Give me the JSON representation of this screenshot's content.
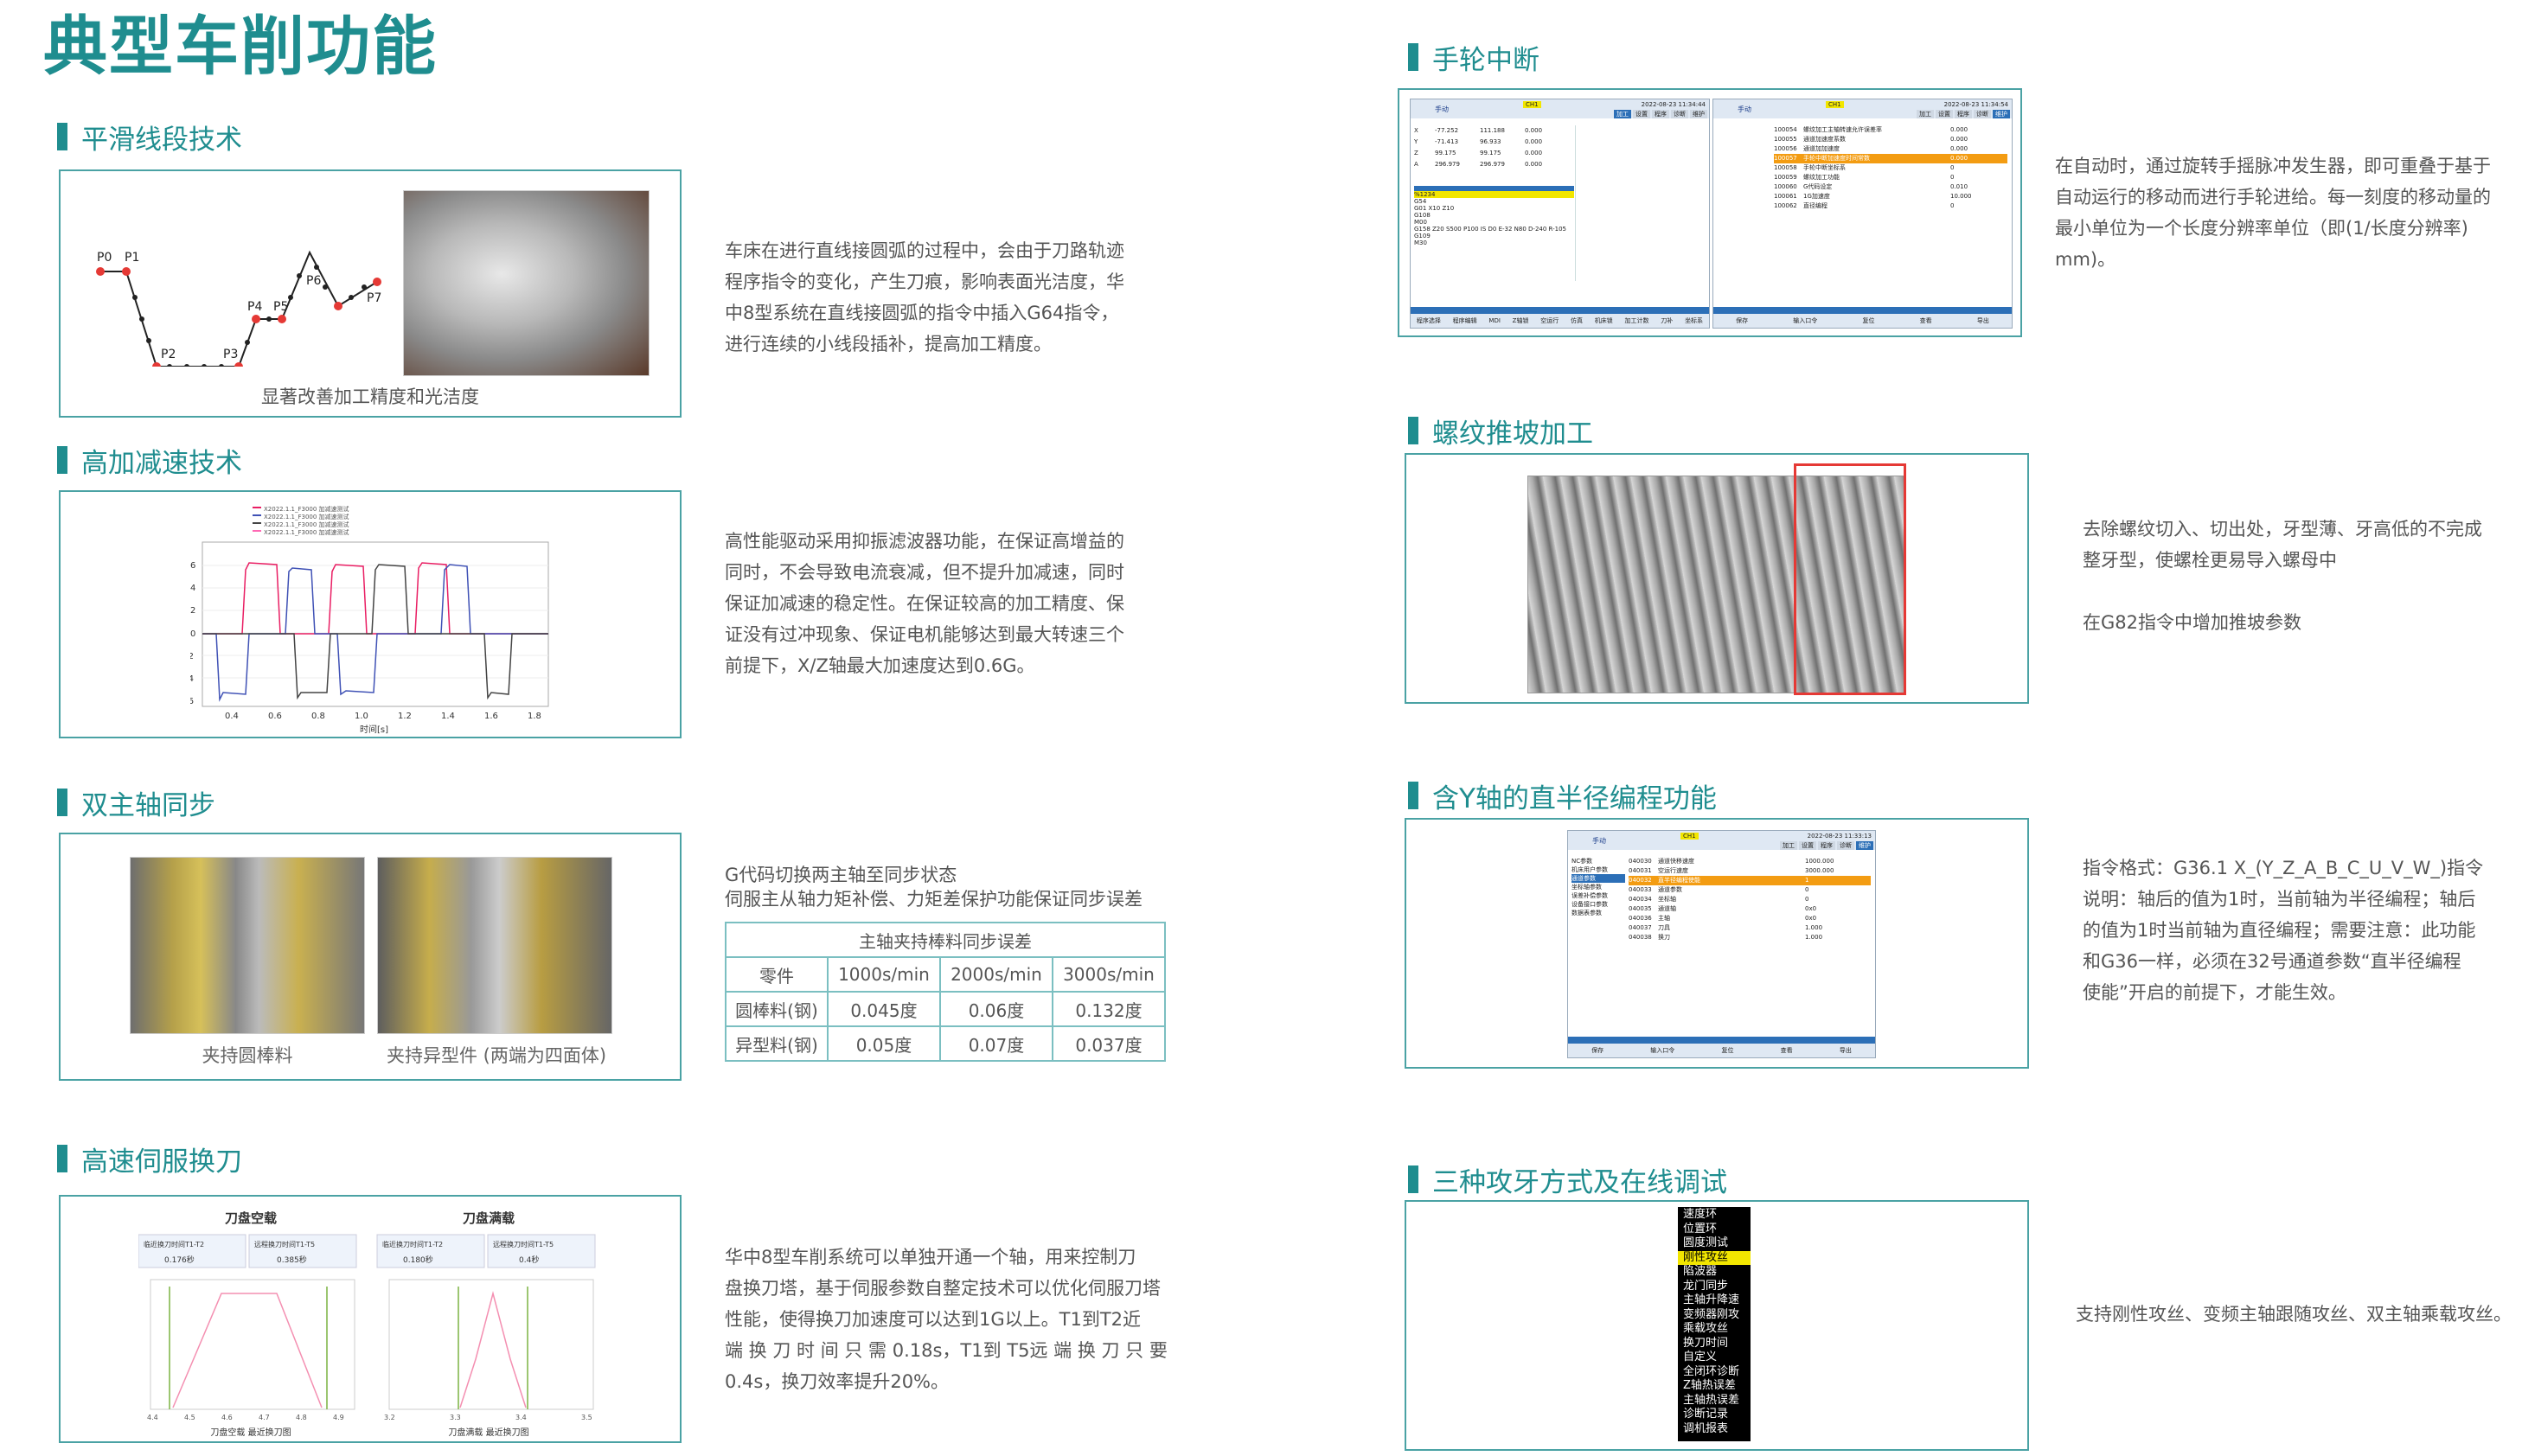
{
  "page": {
    "title": "典型车削功能"
  },
  "sections": {
    "smooth": {
      "title": "平滑线段技术",
      "caption": "显著改善加工精度和光洁度",
      "desc": [
        "车床在进行直线接圆弧的过程中，会由于刀路轨迹",
        "程序指令的变化，产生刀痕，影响表面光洁度，华",
        "中8型系统在直线接圆弧的指令中插入G64指令，",
        "进行连续的小线段插补，提高加工精度。"
      ],
      "path_labels": [
        "P0",
        "P1",
        "P2",
        "P3",
        "P4",
        "P5",
        "P6",
        "P7"
      ]
    },
    "accel": {
      "title": "高加减速技术",
      "desc": [
        "高性能驱动采用抑振滤波器功能，在保证高增益的",
        "同时，不会导致电流衰减，但不提升加减速，同时",
        "保证加减速的稳定性。在保证较高的加工精度、保",
        "证没有过冲现象、保证电机能够达到最大转速三个",
        "前提下，X/Z轴最大加速度达到0.6G。"
      ]
    },
    "dual": {
      "title": "双主轴同步",
      "captions": [
        "夹持圆棒料",
        "夹持异型件 (两端为四面体)"
      ],
      "desc": [
        "G代码切换两主轴至同步状态",
        "伺服主从轴力矩补偿、力矩差保护功能保证同步误差"
      ],
      "table": {
        "title": "主轴夹持棒料同步误差",
        "headers": [
          "零件",
          "1000s/min",
          "2000s/min",
          "3000s/min"
        ],
        "rows": [
          [
            "圆棒料(钢)",
            "0.045度",
            "0.06度",
            "0.132度"
          ],
          [
            "异型料(钢)",
            "0.05度",
            "0.07度",
            "0.037度"
          ]
        ]
      }
    },
    "servo": {
      "title": "高速伺服换刀",
      "desc": [
        "华中8型车削系统可以单独开通一个轴，用来控制刀",
        "盘换刀塔，基于伺服参数自整定技术可以优化伺服刀塔",
        "性能，使得换刀加速度可以达到1G以上。T1到T2近",
        "端 换 刀 时 间 只 需 0.18s，T1到 T5远 端 换 刀 只 要",
        "0.4s，换刀效率提升20%。"
      ],
      "charts": [
        {
          "title": "刀盘空载",
          "stat_labels": [
            "临近换刀时间T1-T2",
            "远程换刀时间T1-T5"
          ],
          "stat_values": [
            "0.176秒",
            "0.385秒"
          ],
          "caption": "刀盘空载 最近换刀图",
          "ticks": [
            "4.4",
            "4.5",
            "4.6",
            "4.7",
            "4.8",
            "4.9"
          ]
        },
        {
          "title": "刀盘满载",
          "stat_labels": [
            "临近换刀时间T1-T2",
            "远程换刀时间T1-T5"
          ],
          "stat_values": [
            "0.180秒",
            "0.4秒"
          ],
          "caption": "刀盘满载 最近换刀图",
          "ticks": [
            "3.2",
            "3.3",
            "3.4",
            "3.5"
          ]
        }
      ]
    },
    "handwheel": {
      "title": "手轮中断",
      "desc": [
        "在自动时，通过旋转手摇脉冲发生器，即可重叠于基于",
        "自动运行的移动而进行手轮进给。每一刻度的移动量的",
        "最小单位为一个长度分辨率单位（即(1/长度分辨率)",
        "mm)。"
      ]
    },
    "thread": {
      "title": "螺纹推坡加工",
      "desc": [
        "去除螺纹切入、切出处，牙型薄、牙高低的不完成",
        "整牙型，使螺栓更易导入螺母中"
      ],
      "desc2": "在G82指令中增加推坡参数"
    },
    "yaxis": {
      "title": "含Y轴的直半径编程功能",
      "desc": [
        "指令格式：G36.1 X_(Y_Z_A_B_C_U_V_W_)指令",
        "说明：轴后的值为1时，当前轴为半径编程；轴后",
        "的值为1时当前轴为直径编程；需要注意：此功能",
        "和G36一样，必须在32号通道参数“直半径编程",
        "使能”开启的前提下，才能生效。"
      ]
    },
    "tapping": {
      "title": "三种攻牙方式及在线调试",
      "menu": [
        "速度环",
        "位置环",
        "圆度测试",
        "刚性攻丝",
        "陷波器",
        "龙门同步",
        "主轴升降速",
        "变频器刚攻",
        "乘载攻丝",
        "换刀时间",
        "自定义",
        "全闭环诊断",
        "Z轴热误差",
        "主轴热误差",
        "诊断记录",
        "调机报表"
      ],
      "selected_index": 3,
      "desc": "支持刚性攻丝、变频主轴跟随攻丝、双主轴乘载攻丝。"
    }
  },
  "cnc_screens": {
    "handwheel_left": {
      "mode": "手动",
      "channel": "CH1",
      "datetime": "2022-08-23 11:34:44",
      "tabs": [
        "加工",
        "设置",
        "程序",
        "诊断",
        "维护"
      ],
      "axes": [
        [
          "X",
          "-77.252",
          "111.188",
          "0.000"
        ],
        [
          "Y",
          "-71.413",
          "96.933",
          "0.000"
        ],
        [
          "Z",
          "99.175",
          "99.175",
          "0.000"
        ],
        [
          "A",
          "296.979",
          "296.979",
          "0.000"
        ]
      ],
      "program": [
        "%1234",
        "G54",
        "G01 X10 Z10",
        "G108",
        "M00",
        "G158 Z20 S500 P100 IS D0 E-32 N80 D-240 R-105",
        "G109",
        "M30"
      ],
      "softkeys": [
        "程序选择",
        "程序编辑",
        "MDI",
        "Z轴锁",
        "空运行",
        "仿真",
        "机床锁",
        "加工计数",
        "刀补",
        "坐标系"
      ]
    },
    "handwheel_right": {
      "mode": "手动",
      "channel": "CH1",
      "datetime": "2022-08-23 11:34:54",
      "tabs": [
        "加工",
        "设置",
        "程序",
        "诊断",
        "维护"
      ],
      "params": [
        [
          "100054",
          "螺纹加工主轴转速允许误差率",
          "0.000"
        ],
        [
          "100055",
          "通道加速度系数",
          "0.000"
        ],
        [
          "100056",
          "通道加加速度",
          "0.000"
        ],
        [
          "100057",
          "手轮中断加速度时间常数",
          "0.000"
        ],
        [
          "100058",
          "手轮中断坐标系",
          "0"
        ],
        [
          "100059",
          "螺纹加工功能",
          "0"
        ],
        [
          "100060",
          "G代码设定",
          "0.010"
        ],
        [
          "100061",
          "1G加速度",
          "10.000"
        ],
        [
          "100062",
          "直径编程",
          "0"
        ]
      ],
      "softkeys": [
        "保存",
        "输入口令",
        "复位",
        "查看",
        "导出"
      ]
    },
    "yaxis_screen": {
      "mode": "手动",
      "channel": "CH1",
      "datetime": "2022-08-23 11:33:13",
      "tabs": [
        "加工",
        "设置",
        "程序",
        "诊断",
        "维护"
      ],
      "nav": [
        "NC参数",
        "机床用户参数",
        "通道参数",
        "坐标轴参数",
        "误差补偿参数",
        "设备接口参数",
        "数据表参数"
      ],
      "params": [
        [
          "040030",
          "通道快移速度",
          "1000.000"
        ],
        [
          "040031",
          "空运行速度",
          "3000.000"
        ],
        [
          "040032",
          "直半径编程使能",
          "1"
        ],
        [
          "040033",
          "通道参数",
          "0"
        ],
        [
          "040034",
          "坐标轴",
          "0"
        ],
        [
          "040035",
          "通道轴",
          "0x0"
        ],
        [
          "040036",
          "主轴",
          "0x0"
        ],
        [
          "040037",
          "刀具",
          "1.000"
        ],
        [
          "040038",
          "换刀",
          "1.000"
        ]
      ],
      "softkeys": [
        "保存",
        "输入口令",
        "复位",
        "查看",
        "导出"
      ]
    }
  },
  "accel_chart": {
    "legend": [
      "X2022.1.1_F3000 加减速测试",
      "X2022.1.1_F3000 加减速测试",
      "X2022.1.1_F3000 加减速测试",
      "X2022.1.1_F3000 加减速测试"
    ],
    "y_ticks": [
      "6",
      "4",
      "2",
      "0",
      "-2",
      "-4",
      "-6"
    ],
    "x_ticks": [
      "0.4",
      "0.6",
      "0.8",
      "1.0",
      "1.2",
      "1.4",
      "1.6",
      "1.8"
    ],
    "xlabel": "时间[s]"
  },
  "colors": {
    "accent": "#1f8d8f",
    "border": "#4aa2a4",
    "highlight": "#f2e600",
    "screen_blue": "#2c6fb7"
  }
}
